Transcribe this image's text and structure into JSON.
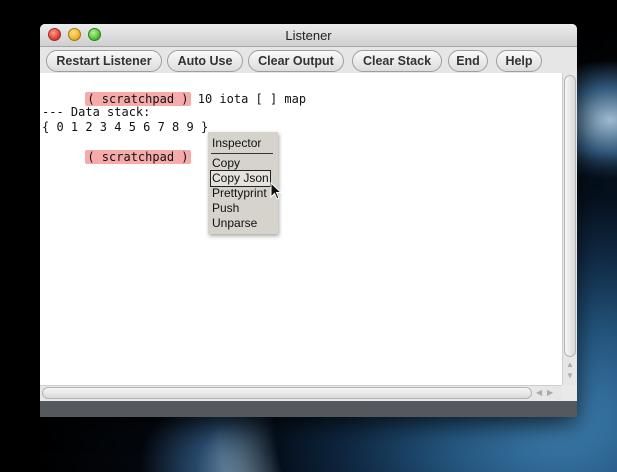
{
  "window": {
    "title": "Listener"
  },
  "toolbar": {
    "buttons": [
      {
        "label": "Restart Listener"
      },
      {
        "label": "Auto Use"
      },
      {
        "label": "Clear Output"
      },
      {
        "label": "Clear Stack"
      },
      {
        "label": "End"
      },
      {
        "label": "Help"
      }
    ]
  },
  "output": {
    "line1_tag": "( scratchpad )",
    "line1_cmd": " 10 iota [ ] map",
    "stack_header": "--- Data stack:",
    "stack_value": "{ 0 1 2 3 4 5 6 7 8 9 }",
    "line3_tag": "( scratchpad )"
  },
  "context_menu": {
    "title": "Inspector",
    "items": [
      {
        "label": "Copy"
      },
      {
        "label": "Copy Json",
        "selected": true
      },
      {
        "label": "Prettyprint"
      },
      {
        "label": "Push"
      },
      {
        "label": "Unparse"
      }
    ]
  },
  "colors": {
    "prompt_highlight": "#f7aaaa",
    "menu_background": "#d6d2cc",
    "status_bar": "#55585c"
  }
}
